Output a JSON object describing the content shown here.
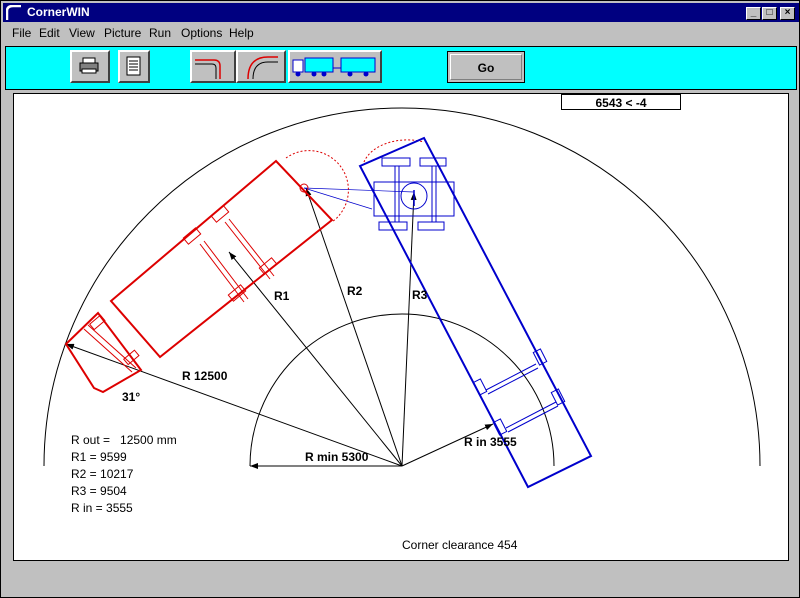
{
  "window": {
    "title": "CornerWIN",
    "minimize": "_",
    "maximize": "□",
    "close": "×"
  },
  "menu": [
    "File",
    "Edit",
    "View",
    "Picture",
    "Run",
    "Options",
    "Help"
  ],
  "toolbar": {
    "go_label": "Go"
  },
  "canvas": {
    "readout": "6543 < -4",
    "labels": {
      "r1": "R1",
      "r2": "R2",
      "r3": "R3",
      "r_outer": "R  12500",
      "r_min": "R min  5300",
      "r_in": "R in   3555",
      "angle": "31°"
    },
    "stats": {
      "r_out": "R out =   12500 mm",
      "r1": "R1 = 9599",
      "r2": "R2 = 10217",
      "r3": "R3 = 9504",
      "r_in": "R in = 3555"
    },
    "clearance": "Corner clearance  454",
    "colors": {
      "trailer": "#dd0000",
      "truck": "#0000cc",
      "dashed": "#dd0000"
    }
  }
}
